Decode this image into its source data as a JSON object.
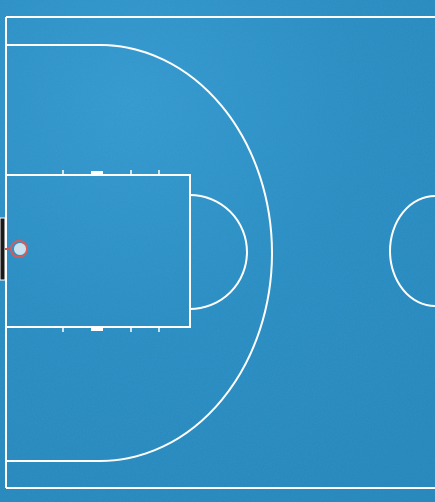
{
  "image": {
    "subject": "basketball-court-aerial-view",
    "colors": {
      "court": "#2f93c8",
      "lines": "#ffffff",
      "backboard": "#1b1b1b",
      "rim": "#d45b5b",
      "net": "#ffffff"
    }
  }
}
